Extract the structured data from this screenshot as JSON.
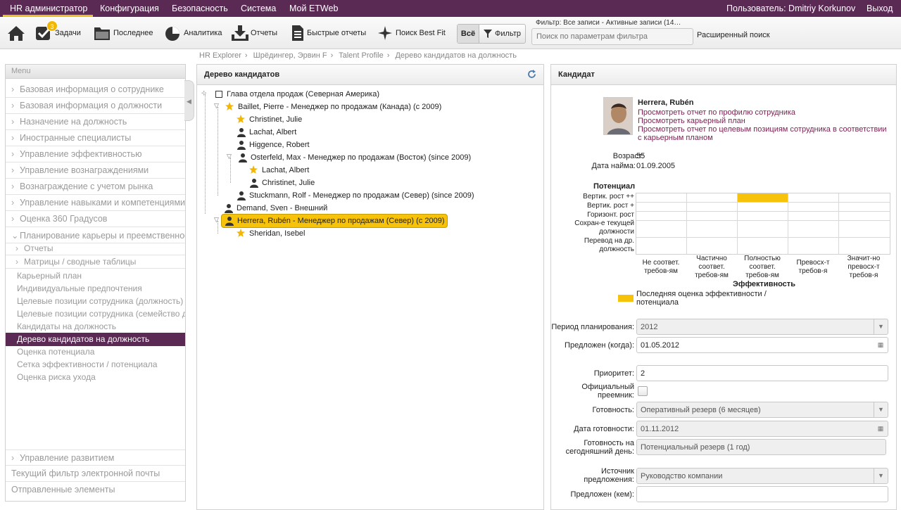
{
  "topnav": {
    "items": [
      "HR администратор",
      "Конфигурация",
      "Безопасность",
      "Система",
      "Мой ETWeb"
    ],
    "user": "Пользователь: Dmitriy Korkunov",
    "logout": "Выход"
  },
  "toolbar": {
    "home_icon": "home-icon",
    "tasks_label": "Задачи",
    "tasks_badge": "3",
    "recent_label": "Последнее",
    "analytics_label": "Аналитика",
    "reports_label": "Отчеты",
    "quick_reports_label": "Быстрые отчеты",
    "best_fit_label": "Поиск Best Fit",
    "all_label": "Всё",
    "filter_label": "Фильтр",
    "filter_caption": "Фильтр: Все записи - Активные записи (14…",
    "search_placeholder": "Поиск по параметрам фильтра",
    "advanced_search": "Расширенный поиск"
  },
  "breadcrumb": [
    "HR Explorer",
    "Шрёдингер, Эрвин F",
    "Talent Profile",
    "Дерево кандидатов на должность"
  ],
  "menu": {
    "header": "Menu",
    "sections": [
      "Базовая информация о сотруднике",
      "Базовая информация о должности",
      "Назначение на должность",
      "Иностранные специалисты",
      "Управление эффективностью",
      "Управление вознаграждениями",
      "Вознаграждение с учетом рынка",
      "Управление навыками и компетенциями",
      "Оценка 360 Градусов",
      "Планирование карьеры и преемственности"
    ],
    "subsections": [
      "Отчеты",
      "Матрицы / сводные таблицы"
    ],
    "items": [
      "Карьерный план",
      "Индивидуальные предпочтения",
      "Целевые позиции сотрудника (должность)",
      "Целевые позиции сотрудника (семейство должностей)",
      "Кандидаты на должность",
      "Дерево кандидатов на должность",
      "Оценка потенциала",
      "Сетка эффективности / потенциала",
      "Оценка риска ухода"
    ],
    "bottom": [
      "Управление развитием",
      "Текущий фильтр электронной почты",
      "Отправленные элементы"
    ]
  },
  "tree": {
    "title": "Дерево кандидатов",
    "nodes": [
      "Глава отдела продаж (Северная Америка)",
      "Baillet, Pierre - Менеджер по продажам (Канада) (с 2009)",
      "Christinet, Julie",
      "Lachat, Albert",
      "Higgence, Robert",
      "Osterfeld, Max - Менеджер по продажам (Восток) (since 2009)",
      "Lachat, Albert",
      "Christinet, Julie",
      "Stuckmann, Rolf - Менеджер по продажам (Север) (since 2009)",
      "Demand, Sven - Внешний",
      "Herrera, Rubén - Менеджер по продажам (Север) (с 2009)",
      "Sheridan, Isebel"
    ]
  },
  "candidate": {
    "panel_title": "Кандидат",
    "name": "Herrera, Rubén",
    "links": [
      "Просмотреть отчет по профилю сотрудника",
      "Просмотреть карьерный план",
      "Просмотреть отчет по целевым позициям сотрудника в соответствии",
      "с карьерным планом"
    ],
    "age_label": "Возраст:",
    "age": "55",
    "hire_label": "Дата найма:",
    "hire_date": "01.09.2005",
    "potential_label": "Потенциал",
    "rows": [
      "Вертик. рост ++",
      "Вертик. рост +",
      "Горизонт. рост",
      "Сохран-е текущей",
      "должности",
      "Перевод на др.",
      "должность"
    ],
    "cols": [
      "Не соответ.",
      "требов-ям",
      "Частично",
      "соответ.",
      "требов-ям",
      "Полностью",
      "соответ.",
      "требов-ям",
      "Превосх-т",
      "требов-я",
      "Значит-но",
      "превосх-т",
      "требов-я"
    ],
    "performance_label": "Эффективность",
    "legend": [
      "Последняя оценка эффективности /",
      "потенциала"
    ],
    "accent": "#f7c20a",
    "fields": {
      "period_label": "Период планирования:",
      "period": "2012",
      "proposed_when_label": "Предложен (когда):",
      "proposed_when": "01.05.2012",
      "priority_label": "Приоритет:",
      "priority": "2",
      "official_label_1": "Официальный",
      "official_label_2": "преемник:",
      "readiness_label": "Готовность:",
      "readiness": "Оперативный резерв (6 месяцев)",
      "readiness_date_label": "Дата готовности:",
      "readiness_date": "01.11.2012",
      "readiness_today_label_1": "Готовность на",
      "readiness_today_label_2": "сегодняшний день:",
      "readiness_today": "Потенциальный резерв (1 год)",
      "source_label_1": "Источник",
      "source_label_2": "предложения:",
      "source": "Руководство компании",
      "proposed_by_label": "Предложен (кем):",
      "proposed_by": ""
    }
  }
}
